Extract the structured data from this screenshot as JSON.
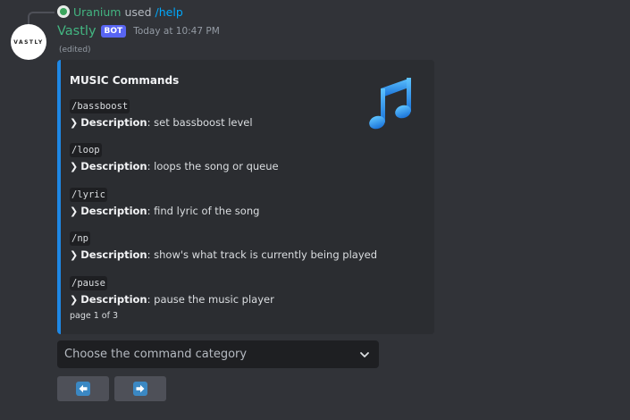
{
  "reply": {
    "user": "Uranium",
    "verb": "used",
    "command": "/help"
  },
  "message": {
    "avatar_text": "VASTLY",
    "username": "Vastly",
    "bot_tag": "BOT",
    "timestamp": "Today at 10:47 PM",
    "edited": "(edited)"
  },
  "embed": {
    "accent_color": "#1e88e5",
    "title": "MUSIC Commands",
    "thumbnail": "musical-notes-icon",
    "desc_label": "Description",
    "commands": [
      {
        "name": "/bassboost",
        "description": ": set bassboost level"
      },
      {
        "name": "/loop",
        "description": ": loops the song or queue"
      },
      {
        "name": "/lyric",
        "description": ": find lyric of the song"
      },
      {
        "name": "/np",
        "description": ": show's what track is currently being played"
      },
      {
        "name": "/pause",
        "description": ": pause the music player"
      }
    ],
    "footer": "page 1 of 3"
  },
  "select": {
    "placeholder": "Choose the command category"
  },
  "buttons": {
    "previous_icon": "arrow-left-icon",
    "next_icon": "arrow-right-icon"
  }
}
